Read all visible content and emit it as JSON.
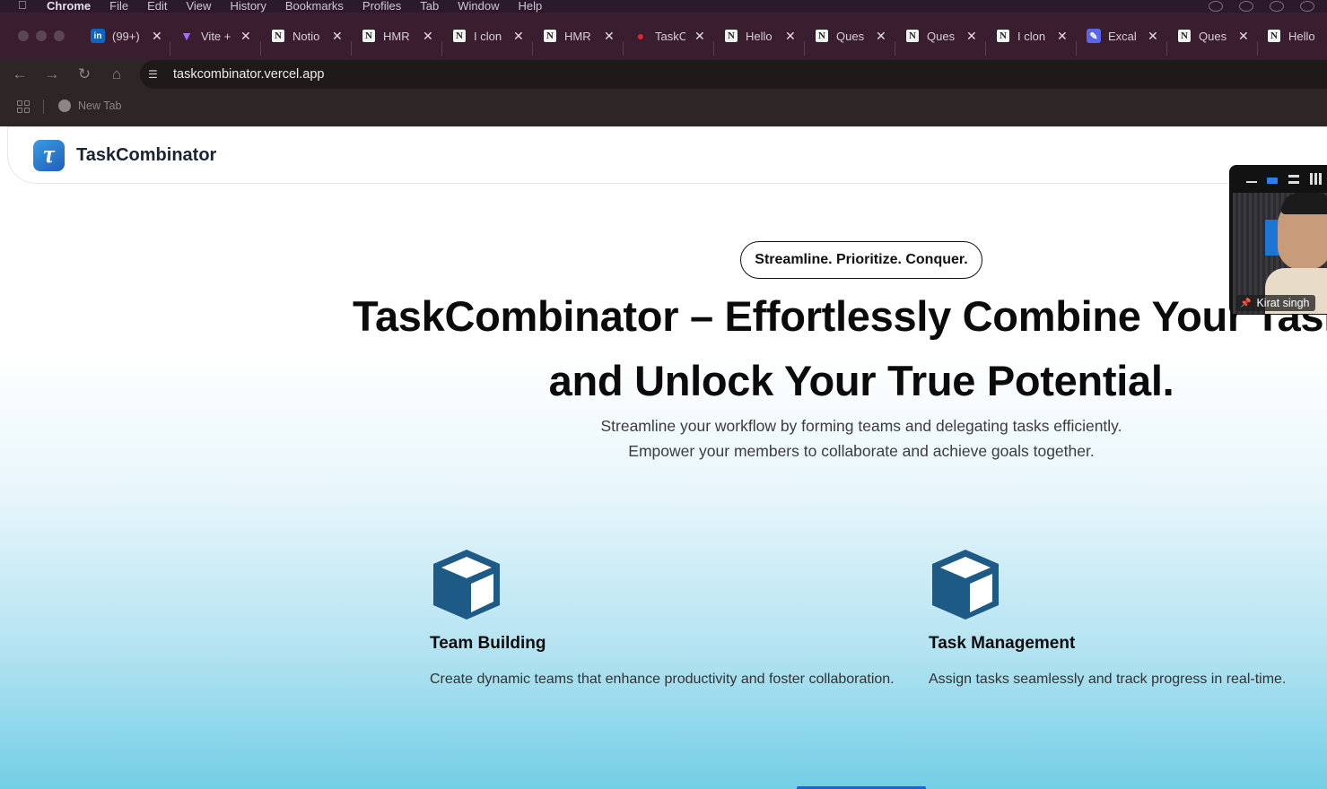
{
  "menubar": {
    "app": "Chrome",
    "items": [
      "File",
      "Edit",
      "View",
      "History",
      "Bookmarks",
      "Profiles",
      "Tab",
      "Window",
      "Help"
    ]
  },
  "tabs": [
    {
      "icon": "linkedin-icon",
      "label": "(99+)"
    },
    {
      "icon": "vite-icon",
      "label": "Vite +"
    },
    {
      "icon": "notion-icon",
      "label": "Notio"
    },
    {
      "icon": "notion-icon",
      "label": "HMR"
    },
    {
      "icon": "notion-icon",
      "label": "I clon"
    },
    {
      "icon": "notion-icon",
      "label": "HMR"
    },
    {
      "icon": "red-dot-icon",
      "label": "TaskC"
    },
    {
      "icon": "notion-icon",
      "label": "Hello"
    },
    {
      "icon": "notion-icon",
      "label": "Ques"
    },
    {
      "icon": "notion-icon",
      "label": "Ques"
    },
    {
      "icon": "notion-icon",
      "label": "I clon"
    },
    {
      "icon": "excalidraw-icon",
      "label": "Excal"
    },
    {
      "icon": "notion-icon",
      "label": "Ques"
    },
    {
      "icon": "notion-icon",
      "label": "Hello"
    }
  ],
  "toolbar": {
    "url": "taskcombinator.vercel.app"
  },
  "bookmarks": {
    "items": [
      {
        "label": "New Tab"
      }
    ]
  },
  "site": {
    "brand": "TaskCombinator",
    "logo_letter": "τ",
    "badge": "Streamline. Prioritize. Conquer.",
    "hero_line1": "TaskCombinator – Effortlessly Combine Your Tasks",
    "hero_line2": "and Unlock Your True Potential.",
    "sub_line1": "Streamline your workflow by forming teams and delegating tasks efficiently.",
    "sub_line2": "Empower your members to collaborate and achieve goals together.",
    "features": [
      {
        "icon": "cube-icon",
        "title": "Team Building",
        "desc": "Create dynamic teams that enhance productivity and foster collaboration."
      },
      {
        "icon": "cube-icon",
        "title": "Task Management",
        "desc": "Assign tasks seamlessly and track progress in real-time."
      }
    ]
  },
  "video_overlay": {
    "participant": "Kirat singh"
  },
  "colors": {
    "accent": "#1d5a85",
    "logo_blue": "#2b7fd4"
  }
}
